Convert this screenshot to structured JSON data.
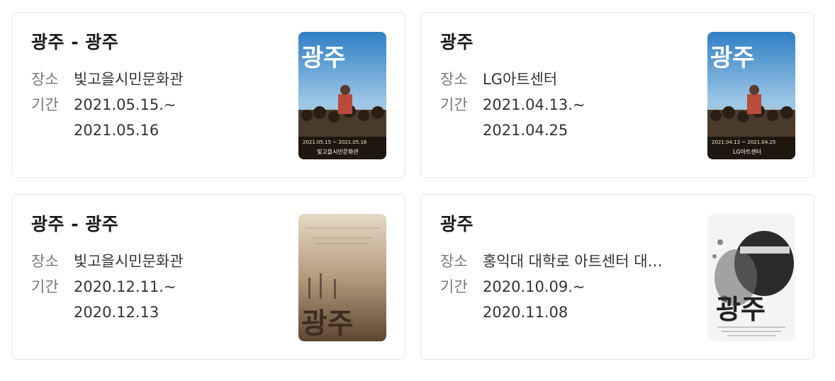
{
  "labels": {
    "venue": "장소",
    "period": "기간"
  },
  "shows": [
    {
      "title": "광주 - 광주",
      "venue": "빛고을시민문화관",
      "start": "2021.05.15.~",
      "end": "2021.05.16",
      "poster": {
        "style": "blue-sky",
        "title_text": "광주",
        "date_text": "2021.05.15 ~ 2021.05.16",
        "venue_text": "빛고을시민문화관"
      }
    },
    {
      "title": "광주",
      "venue": "LG아트센터",
      "start": "2021.04.13.~",
      "end": "2021.04.25",
      "poster": {
        "style": "blue-sky",
        "title_text": "광주",
        "date_text": "2021.04.13 ~ 2021.04.25",
        "venue_text": "LG아트센터"
      }
    },
    {
      "title": "광주 - 광주",
      "venue": "빛고을시민문화관",
      "start": "2020.12.11.~",
      "end": "2020.12.13",
      "poster": {
        "style": "sepia",
        "title_text": "광주"
      }
    },
    {
      "title": "광주",
      "venue": "홍익대 대학로 아트센터 대극장",
      "start": "2020.10.09.~",
      "end": "2020.11.08",
      "poster": {
        "style": "mono",
        "title_text": "광주"
      }
    }
  ]
}
